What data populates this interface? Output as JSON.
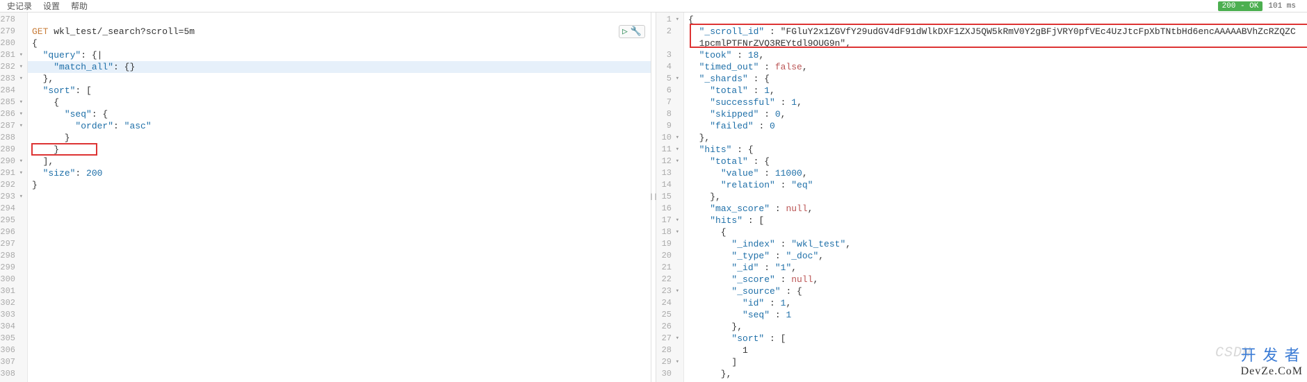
{
  "menubar": {
    "items": [
      "史记录",
      "设置",
      "帮助"
    ]
  },
  "status": {
    "badge": "200 - OK",
    "timing": "101 ms"
  },
  "watermark": {
    "csdn": "CSDN",
    "dev": "开 发 者",
    "site": "DevZe.CoM"
  },
  "left": {
    "startLine": 278,
    "endLine": 308,
    "activeLine": 282,
    "foldLines": [
      281,
      282,
      283,
      285,
      286,
      287,
      290,
      291,
      293
    ],
    "lines": [
      "",
      "GET wkl_test/_search?scroll=5m",
      "{",
      "  \"query\": {|",
      "    \"match_all\": {}",
      "  },",
      "  \"sort\": [",
      "    {",
      "      \"seq\": {",
      "        \"order\": \"asc\"",
      "      }",
      "    }",
      "  ],",
      "  \"size\": 200",
      "}"
    ]
  },
  "right": {
    "startLine": 1,
    "foldLines": [
      1,
      5,
      10,
      11,
      12,
      17,
      18,
      23,
      27,
      29
    ],
    "lines": [
      "{",
      "  \"_scroll_id\" : \"FGluY2x1ZGVfY29udGV4dF91dWlkDXF1ZXJ5QW5kRmV0Y2gBFjVRY0pfVEc4UzJtcFpXbTNtbHd6encAAAAABVhZcRZQZC",
      "  1pcmlPTFNrZVQ3REYtdl9OUG9n\",",
      "  \"took\" : 18,",
      "  \"timed_out\" : false,",
      "  \"_shards\" : {",
      "    \"total\" : 1,",
      "    \"successful\" : 1,",
      "    \"skipped\" : 0,",
      "    \"failed\" : 0",
      "  },",
      "  \"hits\" : {",
      "    \"total\" : {",
      "      \"value\" : 11000,",
      "      \"relation\" : \"eq\"",
      "    },",
      "    \"max_score\" : null,",
      "    \"hits\" : [",
      "      {",
      "        \"_index\" : \"wkl_test\",",
      "        \"_type\" : \"_doc\",",
      "        \"_id\" : \"1\",",
      "        \"_score\" : null,",
      "        \"_source\" : {",
      "          \"id\" : 1,",
      "          \"seq\" : 1",
      "        },",
      "        \"sort\" : [",
      "          1",
      "        ]",
      "      },"
    ]
  },
  "toolbar": {
    "play": "▷",
    "wrench": "🔧"
  }
}
